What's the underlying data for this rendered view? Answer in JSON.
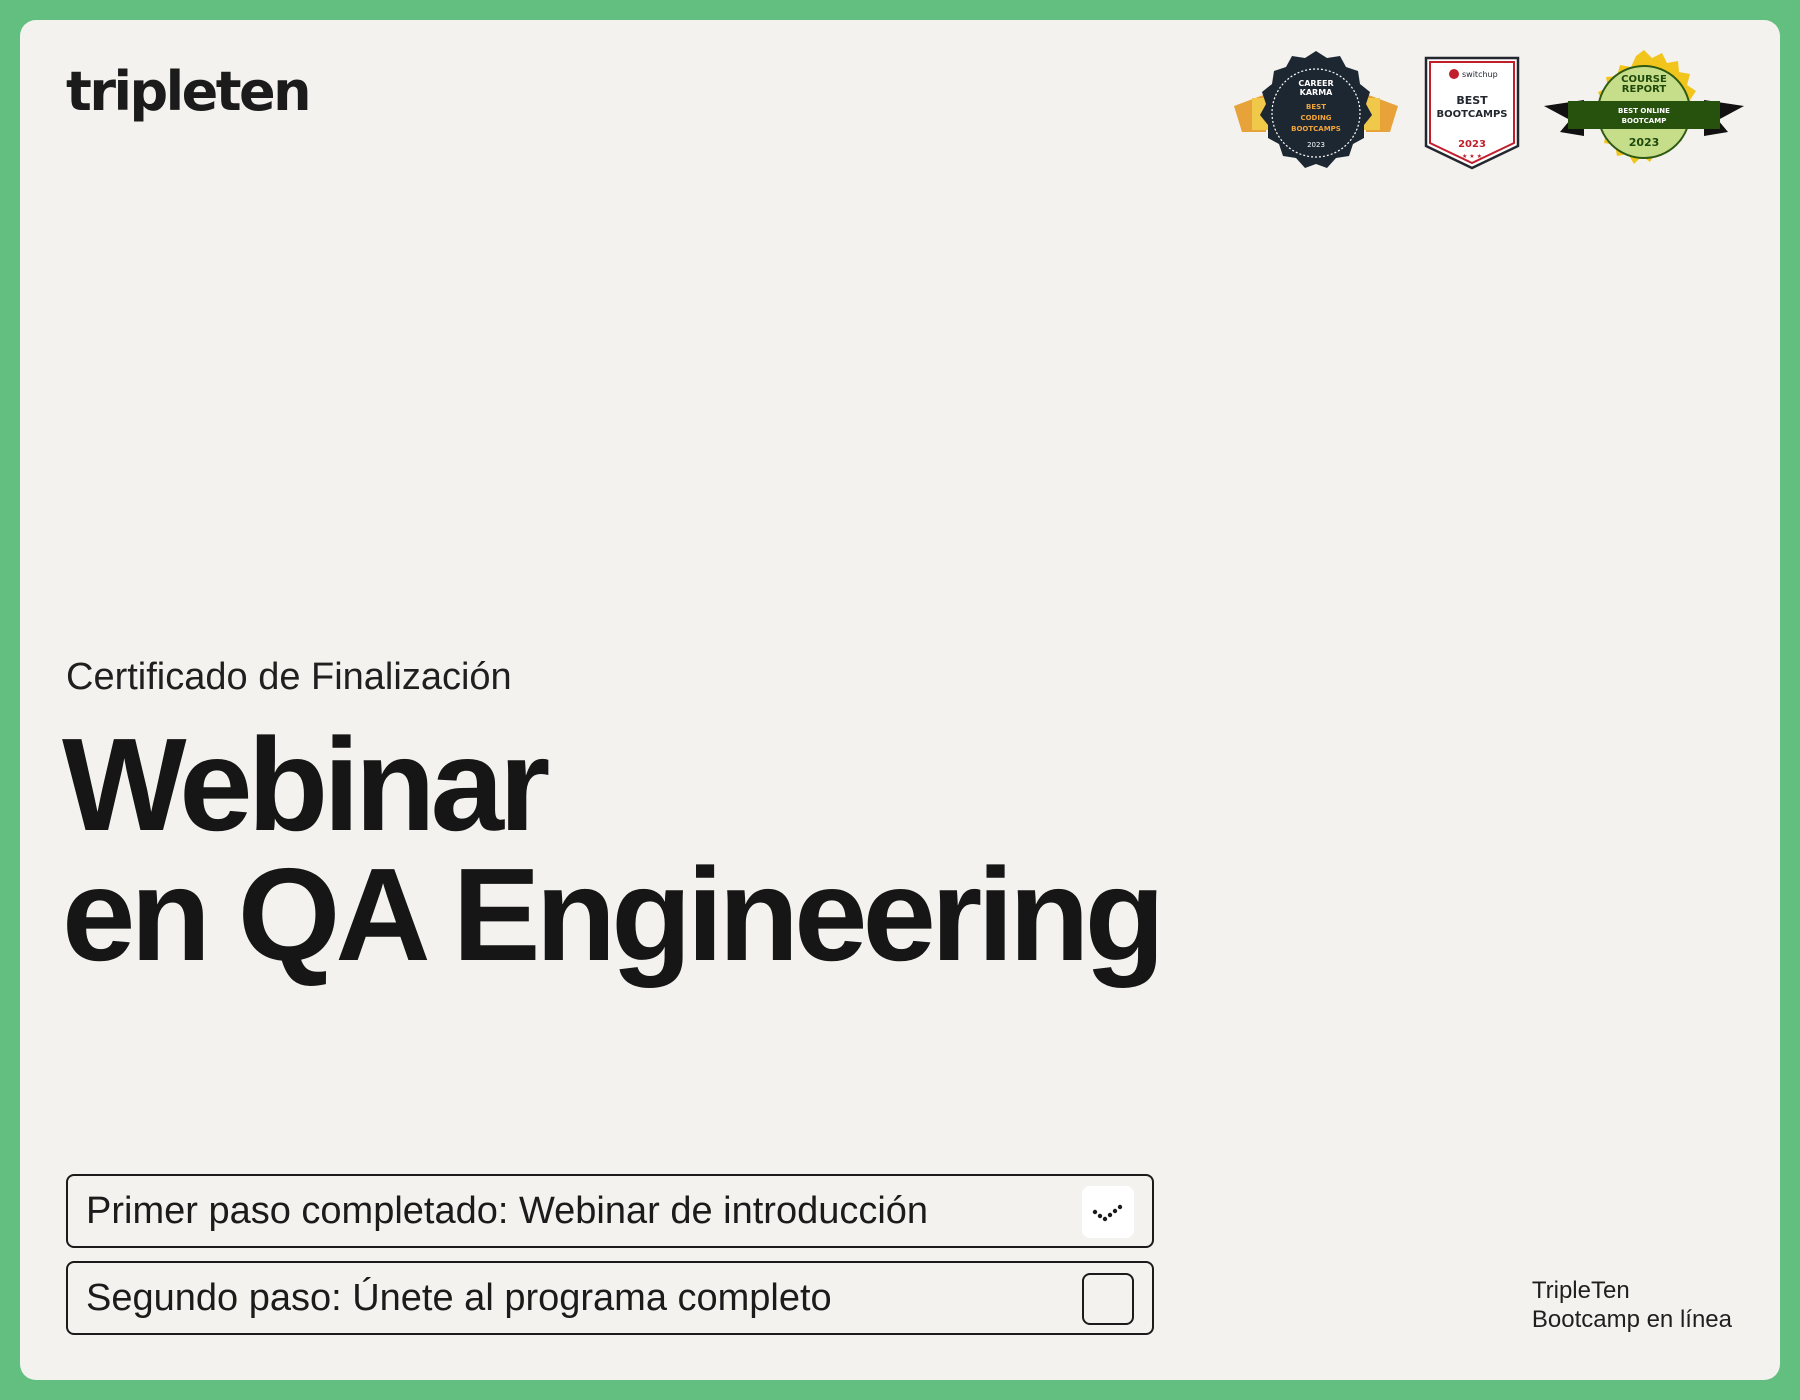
{
  "brand": {
    "logo": "tripleten"
  },
  "badges": [
    {
      "name": "career-karma-badge",
      "lines": [
        "CAREER",
        "KARMA",
        "BEST",
        "CODING",
        "BOOTCAMPS",
        "2023"
      ]
    },
    {
      "name": "switchup-badge",
      "lines": [
        "switchup",
        "BEST",
        "BOOTCAMPS",
        "2023"
      ]
    },
    {
      "name": "course-report-badge",
      "lines": [
        "COURSE",
        "REPORT",
        "BEST ONLINE",
        "BOOTCAMP",
        "2023"
      ]
    }
  ],
  "certificate": {
    "subtitle": "Certificado de Finalización",
    "title_line1": "Webinar",
    "title_line2": "en QA Engineering"
  },
  "steps": [
    {
      "label": "Primer paso completado: Webinar de introducción",
      "done": true
    },
    {
      "label": "Segundo paso: Únete al programa completo",
      "done": false
    }
  ],
  "footer": {
    "line1": "TripleTen",
    "line2": "Bootcamp en línea"
  },
  "colors": {
    "frame": "#63bf80",
    "card": "#f3f2ef",
    "text": "#1a1a1a"
  }
}
